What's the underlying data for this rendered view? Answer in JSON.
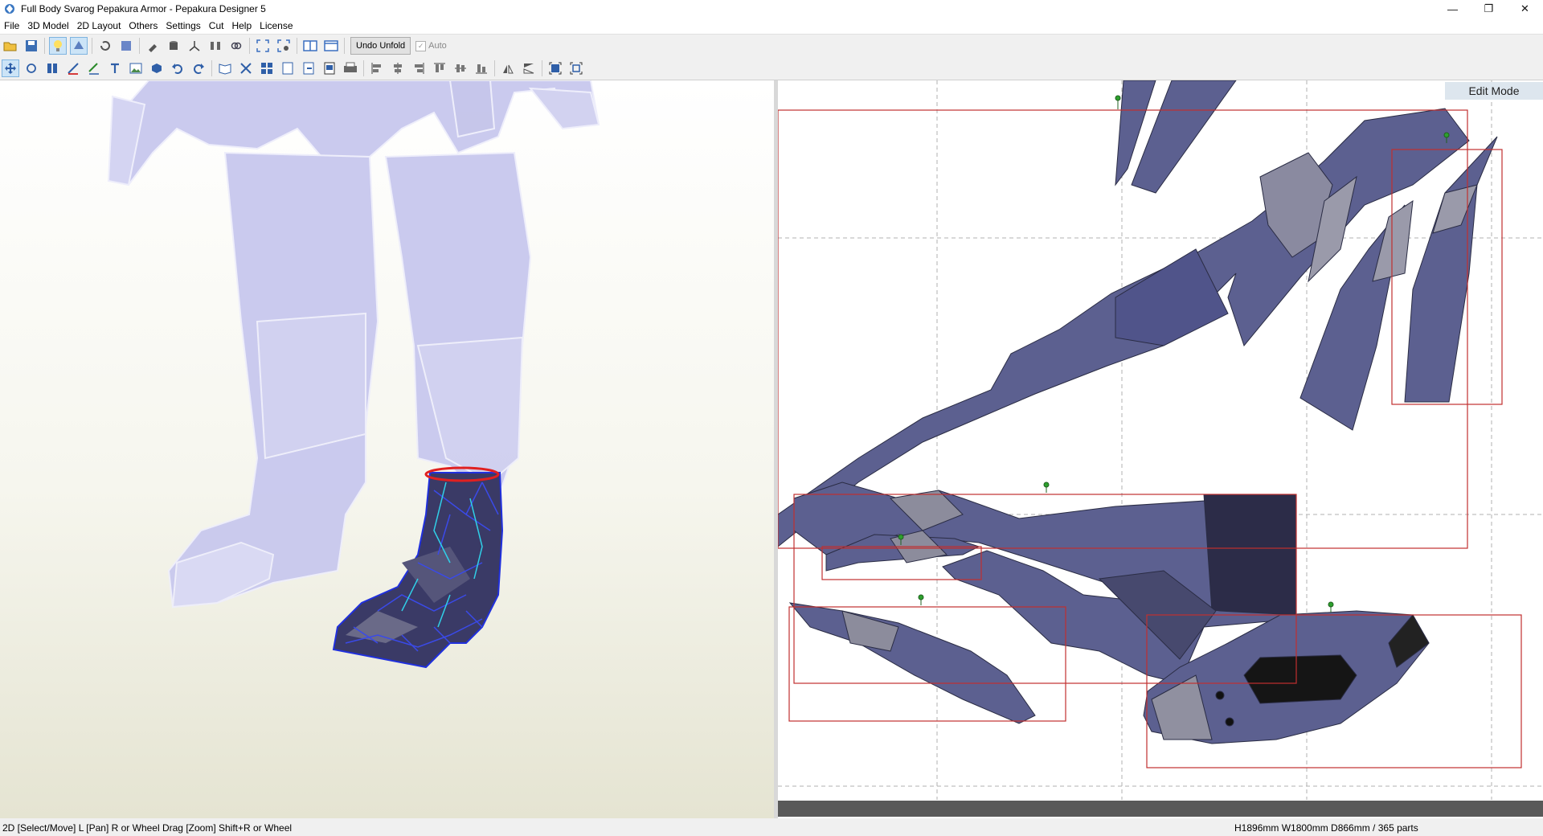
{
  "window": {
    "title": "Full Body Svarog Pepakura Armor - Pepakura Designer 5",
    "minimize": "—",
    "restore": "❐",
    "close": "✕"
  },
  "menu": [
    "File",
    "3D Model",
    "2D Layout",
    "Others",
    "Settings",
    "Cut",
    "Help",
    "License"
  ],
  "toolbar1": {
    "icons": [
      "open-icon",
      "save-icon",
      "light-bulb-icon",
      "unfold-mode-icon",
      "rotate-model-icon",
      "texture-icon",
      "paint-icon",
      "cylinder-icon",
      "axis-icon",
      "mirror-icon",
      "link-icon",
      "fit-view-icon",
      "settings-view-icon",
      "split-view-icon",
      "single-view-icon"
    ],
    "undo_unfold": "Undo Unfold",
    "auto_label": "Auto"
  },
  "toolbar2": {
    "icons": [
      "select-move-icon",
      "rotate-part-icon",
      "join-icon",
      "edge-icon",
      "fold-line-icon",
      "text-icon",
      "image-icon",
      "box-icon",
      "undo-icon",
      "redo-icon",
      "book-icon",
      "arrange-icon",
      "grid-icon",
      "page-add-icon",
      "page-export-icon",
      "print-preview-icon",
      "print-icon",
      "align-left-icon",
      "align-center-icon",
      "align-right-icon",
      "align-top-icon",
      "align-middle-icon",
      "align-bottom-icon",
      "flip-h-icon",
      "flip-v-icon",
      "fit-page-icon",
      "fit-all-icon"
    ]
  },
  "edit_mode": "Edit Mode",
  "status": {
    "left": "2D [Select/Move] L [Pan] R or Wheel Drag [Zoom] Shift+R or Wheel",
    "right": "H1896mm W1800mm D866mm / 365 parts"
  },
  "colors": {
    "model_ghost": "#c8c8ee",
    "model_active": "#3a3a66",
    "wire": "#3040e0",
    "part_fill": "#5c6090",
    "bbox": "#c0302f",
    "page_grid": "#b0b0b0"
  }
}
